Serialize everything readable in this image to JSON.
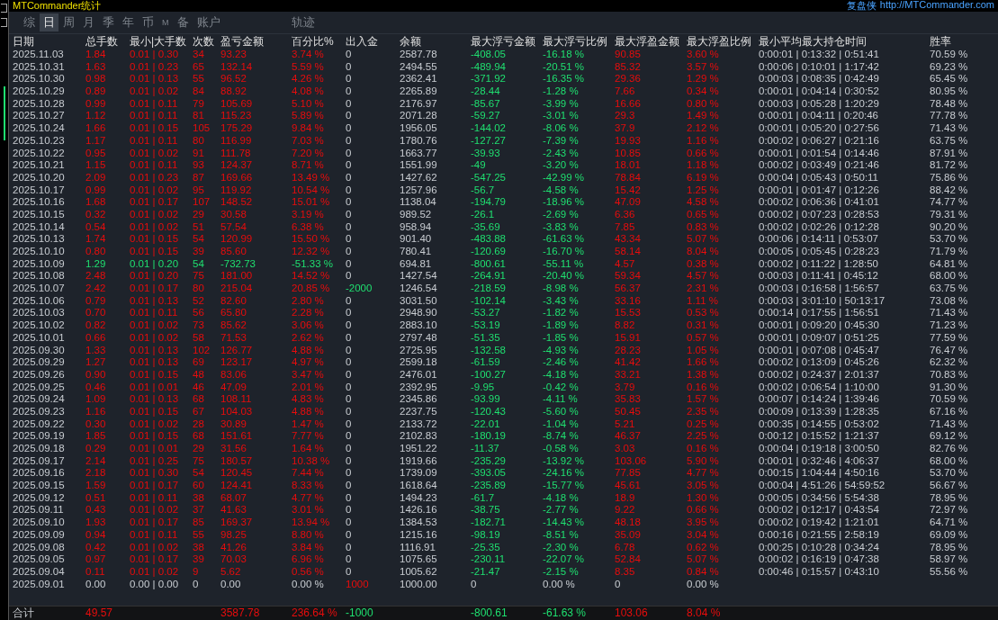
{
  "title": "MTCommander统计",
  "brand": {
    "name": "复盘侠",
    "url": "http://MTCommander.com"
  },
  "tabs": [
    {
      "label": "综",
      "selected": false
    },
    {
      "label": "日",
      "selected": true
    },
    {
      "label": "周",
      "selected": false
    },
    {
      "label": "月",
      "selected": false
    },
    {
      "label": "季",
      "selected": false
    },
    {
      "label": "年",
      "selected": false
    },
    {
      "label": "币",
      "selected": false
    },
    {
      "label": "M",
      "selected": false
    },
    {
      "label": "备",
      "selected": false
    },
    {
      "label": "账户",
      "selected": false
    },
    {
      "label": "轨迹",
      "selected": false
    }
  ],
  "table": {
    "columns": [
      "日期",
      "总手数",
      "最小|大手数",
      "次数",
      "盈亏金额",
      "百分比%",
      "出入金",
      "余额",
      "最大浮亏金额",
      "最大浮亏比例",
      "最大浮盈金额",
      "最大浮盈比例",
      "最小平均最大持仓时间",
      "胜率"
    ],
    "rows": [
      {
        "kind": "profit",
        "deposit": false,
        "withdrawal": false,
        "cells": [
          "2025.11.03",
          "1.84",
          "0.01 | 0.30",
          "34",
          "93.23",
          "3.74 %",
          "0",
          "2587.78",
          "-408.05",
          "-16.18 %",
          "90.85",
          "3.60 %",
          "0:00:01 | 0:13:32 | 0:51:41",
          "70.59 %"
        ]
      },
      {
        "kind": "profit",
        "deposit": false,
        "withdrawal": false,
        "cells": [
          "2025.10.31",
          "1.63",
          "0.01 | 0.23",
          "65",
          "132.14",
          "5.59 %",
          "0",
          "2494.55",
          "-489.94",
          "-20.51 %",
          "85.32",
          "3.57 %",
          "0:00:06 | 0:10:01 | 1:17:42",
          "69.23 %"
        ]
      },
      {
        "kind": "profit",
        "deposit": false,
        "withdrawal": false,
        "cells": [
          "2025.10.30",
          "0.98",
          "0.01 | 0.13",
          "55",
          "96.52",
          "4.26 %",
          "0",
          "2362.41",
          "-371.92",
          "-16.35 %",
          "29.36",
          "1.29 %",
          "0:00:03 | 0:08:35 | 0:42:49",
          "65.45 %"
        ]
      },
      {
        "kind": "profit",
        "deposit": false,
        "withdrawal": false,
        "cells": [
          "2025.10.29",
          "0.89",
          "0.01 | 0.02",
          "84",
          "88.92",
          "4.08 %",
          "0",
          "2265.89",
          "-28.44",
          "-1.28 %",
          "7.66",
          "0.34 %",
          "0:00:01 | 0:04:14 | 0:30:52",
          "80.95 %"
        ]
      },
      {
        "kind": "profit",
        "deposit": false,
        "withdrawal": false,
        "cells": [
          "2025.10.28",
          "0.99",
          "0.01 | 0.11",
          "79",
          "105.69",
          "5.10 %",
          "0",
          "2176.97",
          "-85.67",
          "-3.99 %",
          "16.66",
          "0.80 %",
          "0:00:03 | 0:05:28 | 1:20:29",
          "78.48 %"
        ]
      },
      {
        "kind": "profit",
        "deposit": false,
        "withdrawal": false,
        "cells": [
          "2025.10.27",
          "1.12",
          "0.01 | 0.11",
          "81",
          "115.23",
          "5.89 %",
          "0",
          "2071.28",
          "-59.27",
          "-3.01 %",
          "29.3",
          "1.49 %",
          "0:00:01 | 0:04:11 | 0:20:46",
          "77.78 %"
        ]
      },
      {
        "kind": "profit",
        "deposit": false,
        "withdrawal": false,
        "cells": [
          "2025.10.24",
          "1.66",
          "0.01 | 0.15",
          "105",
          "175.29",
          "9.84 %",
          "0",
          "1956.05",
          "-144.02",
          "-8.06 %",
          "37.9",
          "2.12 %",
          "0:00:01 | 0:05:20 | 0:27:56",
          "71.43 %"
        ]
      },
      {
        "kind": "profit",
        "deposit": false,
        "withdrawal": false,
        "cells": [
          "2025.10.23",
          "1.17",
          "0.01 | 0.11",
          "80",
          "116.99",
          "7.03 %",
          "0",
          "1780.76",
          "-127.27",
          "-7.39 %",
          "19.93",
          "1.16 %",
          "0:00:02 | 0:06:27 | 0:21:16",
          "63.75 %"
        ]
      },
      {
        "kind": "profit",
        "deposit": false,
        "withdrawal": false,
        "cells": [
          "2025.10.22",
          "0.95",
          "0.01 | 0.02",
          "91",
          "111.78",
          "7.20 %",
          "0",
          "1663.77",
          "-39.93",
          "-2.43 %",
          "10.85",
          "0.66 %",
          "0:00:01 | 0:01:54 | 0:14:46",
          "87.91 %"
        ]
      },
      {
        "kind": "profit",
        "deposit": false,
        "withdrawal": false,
        "cells": [
          "2025.10.21",
          "1.15",
          "0.01 | 0.11",
          "93",
          "124.37",
          "8.71 %",
          "0",
          "1551.99",
          "-49",
          "-3.20 %",
          "18.01",
          "1.18 %",
          "0:00:02 | 0:03:49 | 0:21:46",
          "81.72 %"
        ]
      },
      {
        "kind": "profit",
        "deposit": false,
        "withdrawal": false,
        "cells": [
          "2025.10.20",
          "2.09",
          "0.01 | 0.23",
          "87",
          "169.66",
          "13.49 %",
          "0",
          "1427.62",
          "-547.25",
          "-42.99 %",
          "78.84",
          "6.19 %",
          "0:00:04 | 0:05:43 | 0:50:11",
          "75.86 %"
        ]
      },
      {
        "kind": "profit",
        "deposit": false,
        "withdrawal": false,
        "cells": [
          "2025.10.17",
          "0.99",
          "0.01 | 0.02",
          "95",
          "119.92",
          "10.54 %",
          "0",
          "1257.96",
          "-56.7",
          "-4.58 %",
          "15.42",
          "1.25 %",
          "0:00:01 | 0:01:47 | 0:12:26",
          "88.42 %"
        ]
      },
      {
        "kind": "profit",
        "deposit": false,
        "withdrawal": false,
        "cells": [
          "2025.10.16",
          "1.68",
          "0.01 | 0.17",
          "107",
          "148.52",
          "15.01 %",
          "0",
          "1138.04",
          "-194.79",
          "-18.96 %",
          "47.09",
          "4.58 %",
          "0:00:02 | 0:06:36 | 0:41:01",
          "74.77 %"
        ]
      },
      {
        "kind": "profit",
        "deposit": false,
        "withdrawal": false,
        "cells": [
          "2025.10.15",
          "0.32",
          "0.01 | 0.02",
          "29",
          "30.58",
          "3.19 %",
          "0",
          "989.52",
          "-26.1",
          "-2.69 %",
          "6.36",
          "0.65 %",
          "0:00:02 | 0:07:23 | 0:28:53",
          "79.31 %"
        ]
      },
      {
        "kind": "profit",
        "deposit": false,
        "withdrawal": false,
        "cells": [
          "2025.10.14",
          "0.54",
          "0.01 | 0.02",
          "51",
          "57.54",
          "6.38 %",
          "0",
          "958.94",
          "-35.69",
          "-3.83 %",
          "7.85",
          "0.83 %",
          "0:00:02 | 0:02:26 | 0:12:28",
          "90.20 %"
        ]
      },
      {
        "kind": "profit",
        "deposit": false,
        "withdrawal": false,
        "cells": [
          "2025.10.13",
          "1.74",
          "0.01 | 0.15",
          "54",
          "120.99",
          "15.50 %",
          "0",
          "901.40",
          "-483.88",
          "-61.63 %",
          "43.34",
          "5.07 %",
          "0:00:06 | 0:14:11 | 0:53:07",
          "53.70 %"
        ]
      },
      {
        "kind": "profit",
        "deposit": false,
        "withdrawal": false,
        "cells": [
          "2025.10.10",
          "0.80",
          "0.01 | 0.15",
          "39",
          "85.60",
          "12.32 %",
          "0",
          "780.41",
          "-120.69",
          "-16.70 %",
          "58.14",
          "8.04 %",
          "0:00:05 | 0:05:45 | 0:28:23",
          "71.79 %"
        ]
      },
      {
        "kind": "loss",
        "deposit": false,
        "withdrawal": false,
        "cells": [
          "2025.10.09",
          "1.29",
          "0.01 | 0.20",
          "54",
          "-732.73",
          "-51.33 %",
          "0",
          "694.81",
          "-800.61",
          "-55.11 %",
          "4.57",
          "0.38 %",
          "0:00:02 | 0:11:22 | 1:28:50",
          "64.81 %"
        ]
      },
      {
        "kind": "profit",
        "deposit": false,
        "withdrawal": false,
        "cells": [
          "2025.10.08",
          "2.48",
          "0.01 | 0.20",
          "75",
          "181.00",
          "14.52 %",
          "0",
          "1427.54",
          "-264.91",
          "-20.40 %",
          "59.34",
          "4.57 %",
          "0:00:03 | 0:11:41 | 0:45:12",
          "68.00 %"
        ]
      },
      {
        "kind": "profit",
        "deposit": false,
        "withdrawal": true,
        "cells": [
          "2025.10.07",
          "2.42",
          "0.01 | 0.17",
          "80",
          "215.04",
          "20.85 %",
          "-2000",
          "1246.54",
          "-218.59",
          "-8.98 %",
          "56.37",
          "2.31 %",
          "0:00:03 | 0:16:58 | 1:56:57",
          "63.75 %"
        ]
      },
      {
        "kind": "profit",
        "deposit": false,
        "withdrawal": false,
        "cells": [
          "2025.10.06",
          "0.79",
          "0.01 | 0.13",
          "52",
          "82.60",
          "2.80 %",
          "0",
          "3031.50",
          "-102.14",
          "-3.43 %",
          "33.16",
          "1.11 %",
          "0:00:03 | 3:01:10 | 50:13:17",
          "73.08 %"
        ]
      },
      {
        "kind": "profit",
        "deposit": false,
        "withdrawal": false,
        "cells": [
          "2025.10.03",
          "0.70",
          "0.01 | 0.11",
          "56",
          "65.80",
          "2.28 %",
          "0",
          "2948.90",
          "-53.27",
          "-1.82 %",
          "15.53",
          "0.53 %",
          "0:00:14 | 0:17:55 | 1:56:51",
          "71.43 %"
        ]
      },
      {
        "kind": "profit",
        "deposit": false,
        "withdrawal": false,
        "cells": [
          "2025.10.02",
          "0.82",
          "0.01 | 0.02",
          "73",
          "85.62",
          "3.06 %",
          "0",
          "2883.10",
          "-53.19",
          "-1.89 %",
          "8.82",
          "0.31 %",
          "0:00:01 | 0:09:20 | 0:45:30",
          "71.23 %"
        ]
      },
      {
        "kind": "profit",
        "deposit": false,
        "withdrawal": false,
        "cells": [
          "2025.10.01",
          "0.66",
          "0.01 | 0.02",
          "58",
          "71.53",
          "2.62 %",
          "0",
          "2797.48",
          "-51.35",
          "-1.85 %",
          "15.91",
          "0.57 %",
          "0:00:01 | 0:09:07 | 0:51:25",
          "77.59 %"
        ]
      },
      {
        "kind": "profit",
        "deposit": false,
        "withdrawal": false,
        "cells": [
          "2025.09.30",
          "1.33",
          "0.01 | 0.13",
          "102",
          "126.77",
          "4.88 %",
          "0",
          "2725.95",
          "-132.58",
          "-4.93 %",
          "28.23",
          "1.05 %",
          "0:00:01 | 0:07:08 | 0:45:47",
          "76.47 %"
        ]
      },
      {
        "kind": "profit",
        "deposit": false,
        "withdrawal": false,
        "cells": [
          "2025.09.29",
          "1.27",
          "0.01 | 0.13",
          "69",
          "123.17",
          "4.97 %",
          "0",
          "2599.18",
          "-61.59",
          "-2.46 %",
          "41.42",
          "1.66 %",
          "0:00:02 | 0:13:09 | 0:45:26",
          "62.32 %"
        ]
      },
      {
        "kind": "profit",
        "deposit": false,
        "withdrawal": false,
        "cells": [
          "2025.09.26",
          "0.90",
          "0.01 | 0.15",
          "48",
          "83.06",
          "3.47 %",
          "0",
          "2476.01",
          "-100.27",
          "-4.18 %",
          "33.21",
          "1.38 %",
          "0:00:02 | 0:24:37 | 2:01:37",
          "70.83 %"
        ]
      },
      {
        "kind": "profit",
        "deposit": false,
        "withdrawal": false,
        "cells": [
          "2025.09.25",
          "0.46",
          "0.01 | 0.01",
          "46",
          "47.09",
          "2.01 %",
          "0",
          "2392.95",
          "-9.95",
          "-0.42 %",
          "3.79",
          "0.16 %",
          "0:00:02 | 0:06:54 | 1:10:00",
          "91.30 %"
        ]
      },
      {
        "kind": "profit",
        "deposit": false,
        "withdrawal": false,
        "cells": [
          "2025.09.24",
          "1.09",
          "0.01 | 0.13",
          "68",
          "108.11",
          "4.83 %",
          "0",
          "2345.86",
          "-93.99",
          "-4.11 %",
          "35.83",
          "1.57 %",
          "0:00:07 | 0:14:24 | 1:39:46",
          "70.59 %"
        ]
      },
      {
        "kind": "profit",
        "deposit": false,
        "withdrawal": false,
        "cells": [
          "2025.09.23",
          "1.16",
          "0.01 | 0.15",
          "67",
          "104.03",
          "4.88 %",
          "0",
          "2237.75",
          "-120.43",
          "-5.60 %",
          "50.45",
          "2.35 %",
          "0:00:09 | 0:13:39 | 1:28:35",
          "67.16 %"
        ]
      },
      {
        "kind": "profit",
        "deposit": false,
        "withdrawal": false,
        "cells": [
          "2025.09.22",
          "0.30",
          "0.01 | 0.02",
          "28",
          "30.89",
          "1.47 %",
          "0",
          "2133.72",
          "-22.01",
          "-1.04 %",
          "5.21",
          "0.25 %",
          "0:00:35 | 0:14:55 | 0:53:02",
          "71.43 %"
        ]
      },
      {
        "kind": "profit",
        "deposit": false,
        "withdrawal": false,
        "cells": [
          "2025.09.19",
          "1.85",
          "0.01 | 0.15",
          "68",
          "151.61",
          "7.77 %",
          "0",
          "2102.83",
          "-180.19",
          "-8.74 %",
          "46.37",
          "2.25 %",
          "0:00:12 | 0:15:52 | 1:21:37",
          "69.12 %"
        ]
      },
      {
        "kind": "profit",
        "deposit": false,
        "withdrawal": false,
        "cells": [
          "2025.09.18",
          "0.29",
          "0.01 | 0.01",
          "29",
          "31.56",
          "1.64 %",
          "0",
          "1951.22",
          "-11.37",
          "-0.58 %",
          "3.03",
          "0.16 %",
          "0:00:04 | 0:19:18 | 3:00:50",
          "82.76 %"
        ]
      },
      {
        "kind": "profit",
        "deposit": false,
        "withdrawal": false,
        "cells": [
          "2025.09.17",
          "2.14",
          "0.01 | 0.25",
          "75",
          "180.57",
          "10.38 %",
          "0",
          "1919.66",
          "-235.29",
          "-13.92 %",
          "103.06",
          "5.90 %",
          "0:00:01 | 0:32:46 | 4:06:37",
          "68.00 %"
        ]
      },
      {
        "kind": "profit",
        "deposit": false,
        "withdrawal": false,
        "cells": [
          "2025.09.16",
          "2.18",
          "0.01 | 0.30",
          "54",
          "120.45",
          "7.44 %",
          "0",
          "1739.09",
          "-393.05",
          "-24.16 %",
          "77.85",
          "4.77 %",
          "0:00:15 | 1:04:44 | 4:50:16",
          "53.70 %"
        ]
      },
      {
        "kind": "profit",
        "deposit": false,
        "withdrawal": false,
        "cells": [
          "2025.09.15",
          "1.59",
          "0.01 | 0.17",
          "60",
          "124.41",
          "8.33 %",
          "0",
          "1618.64",
          "-235.89",
          "-15.77 %",
          "45.61",
          "3.05 %",
          "0:00:04 | 4:51:26 | 54:59:52",
          "56.67 %"
        ]
      },
      {
        "kind": "profit",
        "deposit": false,
        "withdrawal": false,
        "cells": [
          "2025.09.12",
          "0.51",
          "0.01 | 0.11",
          "38",
          "68.07",
          "4.77 %",
          "0",
          "1494.23",
          "-61.7",
          "-4.18 %",
          "18.9",
          "1.30 %",
          "0:00:05 | 0:34:56 | 5:54:38",
          "78.95 %"
        ]
      },
      {
        "kind": "profit",
        "deposit": false,
        "withdrawal": false,
        "cells": [
          "2025.09.11",
          "0.43",
          "0.01 | 0.02",
          "37",
          "41.63",
          "3.01 %",
          "0",
          "1426.16",
          "-38.75",
          "-2.77 %",
          "9.22",
          "0.66 %",
          "0:00:02 | 0:12:17 | 0:43:54",
          "72.97 %"
        ]
      },
      {
        "kind": "profit",
        "deposit": false,
        "withdrawal": false,
        "cells": [
          "2025.09.10",
          "1.93",
          "0.01 | 0.17",
          "85",
          "169.37",
          "13.94 %",
          "0",
          "1384.53",
          "-182.71",
          "-14.43 %",
          "48.18",
          "3.95 %",
          "0:00:02 | 0:19:42 | 1:21:01",
          "64.71 %"
        ]
      },
      {
        "kind": "profit",
        "deposit": false,
        "withdrawal": false,
        "cells": [
          "2025.09.09",
          "0.94",
          "0.01 | 0.11",
          "55",
          "98.25",
          "8.80 %",
          "0",
          "1215.16",
          "-98.19",
          "-8.51 %",
          "35.09",
          "3.04 %",
          "0:00:16 | 0:21:55 | 2:58:19",
          "69.09 %"
        ]
      },
      {
        "kind": "profit",
        "deposit": false,
        "withdrawal": false,
        "cells": [
          "2025.09.08",
          "0.42",
          "0.01 | 0.02",
          "38",
          "41.26",
          "3.84 %",
          "0",
          "1116.91",
          "-25.35",
          "-2.30 %",
          "6.78",
          "0.62 %",
          "0:00:25 | 0:10:28 | 0:34:24",
          "78.95 %"
        ]
      },
      {
        "kind": "profit",
        "deposit": false,
        "withdrawal": false,
        "cells": [
          "2025.09.05",
          "0.97",
          "0.01 | 0.17",
          "39",
          "70.03",
          "6.96 %",
          "0",
          "1075.65",
          "-230.11",
          "-22.07 %",
          "52.84",
          "5.07 %",
          "0:00:02 | 0:16:19 | 0:47:38",
          "58.97 %"
        ]
      },
      {
        "kind": "profit",
        "deposit": false,
        "withdrawal": false,
        "cells": [
          "2025.09.04",
          "0.11",
          "0.01 | 0.02",
          "9",
          "5.62",
          "0.56 %",
          "0",
          "1005.62",
          "-21.47",
          "-2.15 %",
          "8.35",
          "0.84 %",
          "0:00:46 | 0:15:57 | 0:43:10",
          "55.56 %"
        ]
      },
      {
        "kind": "flat",
        "deposit": true,
        "withdrawal": false,
        "cells": [
          "2025.09.01",
          "0.00",
          "0.00 | 0.00",
          "0",
          "0.00",
          "0.00 %",
          "1000",
          "1000.00",
          "0",
          "0.00 %",
          "0",
          "0.00 %"
        ]
      }
    ],
    "total": {
      "kind": "profit",
      "deposit": false,
      "withdrawal": true,
      "cells": [
        "合计",
        "49.57",
        null,
        null,
        "3587.78",
        "236.64 %",
        "-1000",
        null,
        "-800.61",
        "-61.63 %",
        "103.06",
        "8.04 %"
      ]
    }
  }
}
